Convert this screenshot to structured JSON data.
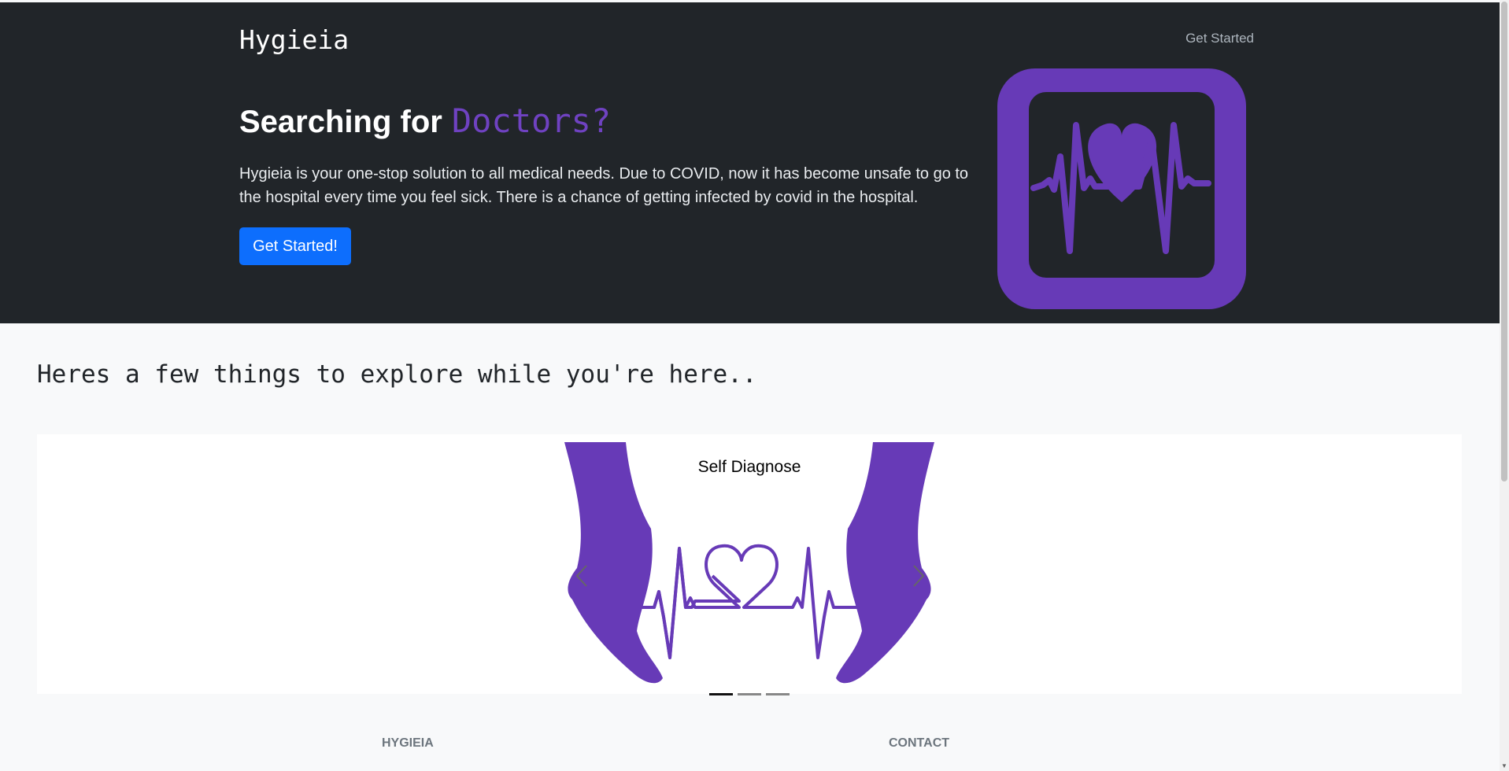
{
  "navbar": {
    "brand": "Hygieia",
    "link": "Get Started"
  },
  "hero": {
    "title_prefix": "Searching for",
    "title_accent": "Doctors?",
    "description": "Hygieia is your one-stop solution to all medical needs. Due to COVID, now it has become unsafe to go to the hospital every time you feel sick. There is a chance of getting infected by covid in the hospital.",
    "cta_label": "Get Started!",
    "logo_icon": "heartbeat-monitor-icon"
  },
  "explore": {
    "title": "Heres a few things to explore while you're here..",
    "carousel": {
      "active_index": 0,
      "slides": [
        {
          "caption": "Self Diagnose",
          "image_icon": "hands-heartbeat-icon"
        }
      ],
      "indicator_count": 3
    }
  },
  "footer": {
    "col1": "HYGIEIA",
    "col2": "CONTACT"
  },
  "colors": {
    "dark": "#212529",
    "accent_purple": "#673ab7",
    "primary_button": "#0d6efd"
  }
}
